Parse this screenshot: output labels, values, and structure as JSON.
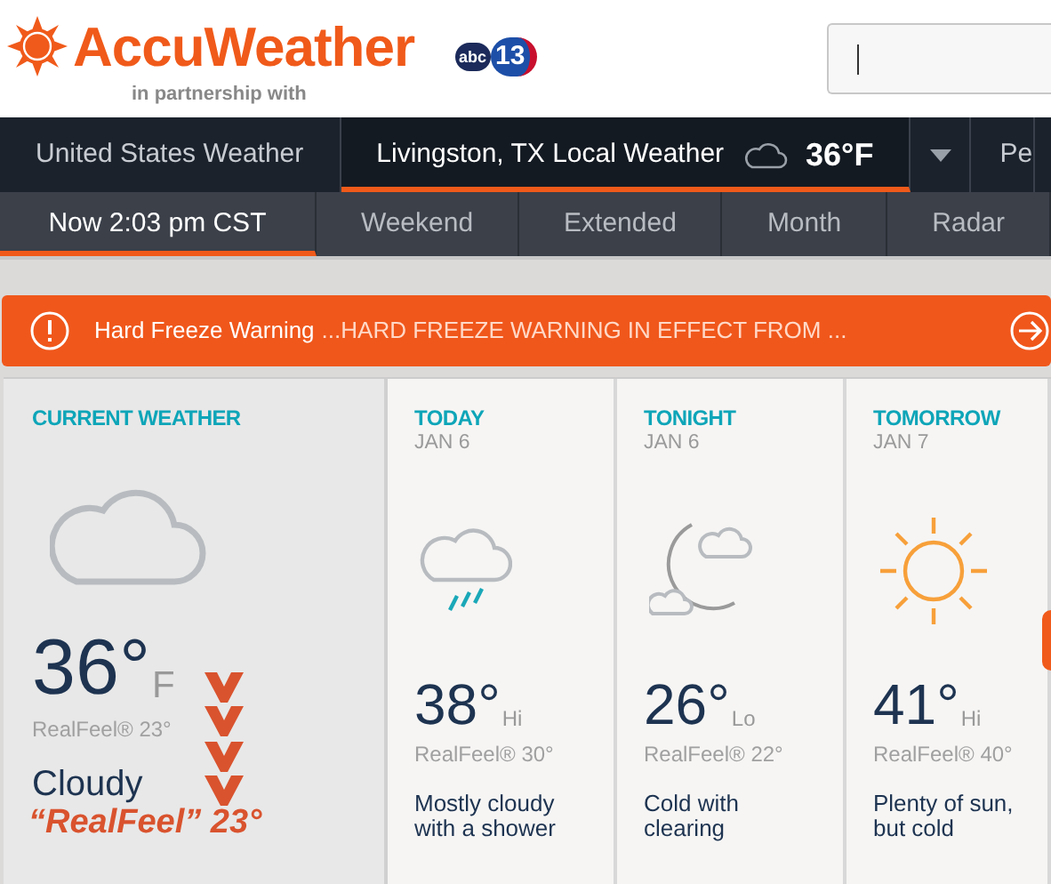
{
  "header": {
    "brand": "AccuWeather",
    "partner_text": "in partnership with",
    "partner_logo": [
      "abc",
      "13"
    ]
  },
  "nav": {
    "items": [
      {
        "label": "United States Weather",
        "selected": false
      },
      {
        "label": "Livingston, TX Local Weather",
        "selected": true,
        "temp": "36°F"
      },
      {
        "label": "Pe",
        "selected": false
      }
    ]
  },
  "subnav": {
    "tabs": [
      {
        "label": "Now 2:03 pm CST",
        "selected": true
      },
      {
        "label": "Weekend",
        "selected": false
      },
      {
        "label": "Extended",
        "selected": false
      },
      {
        "label": "Month",
        "selected": false
      },
      {
        "label": "Radar",
        "selected": false
      }
    ]
  },
  "alert": {
    "title": "Hard Freeze Warning",
    "text": "...HARD FREEZE WARNING IN EFFECT FROM ..."
  },
  "cards": [
    {
      "kind": "current",
      "label": "CURRENT WEATHER",
      "temp": "36°",
      "unit": "F",
      "realfeel": "RealFeel® 23°",
      "phrase": "Cloudy",
      "callout": "“RealFeel” 23°"
    },
    {
      "kind": "forecast",
      "label": "TODAY",
      "date": "JAN 6",
      "temp": "38°",
      "unit": "Hi",
      "realfeel": "RealFeel® 30°",
      "phrase": "Mostly cloudy with a shower"
    },
    {
      "kind": "forecast",
      "label": "TONIGHT",
      "date": "JAN 6",
      "temp": "26°",
      "unit": "Lo",
      "realfeel": "RealFeel® 22°",
      "phrase": "Cold with clearing"
    },
    {
      "kind": "forecast",
      "label": "TOMORROW",
      "date": "JAN 7",
      "temp": "41°",
      "unit": "Hi",
      "realfeel": "RealFeel® 40°",
      "phrase": "Plenty of sun, but cold"
    }
  ]
}
